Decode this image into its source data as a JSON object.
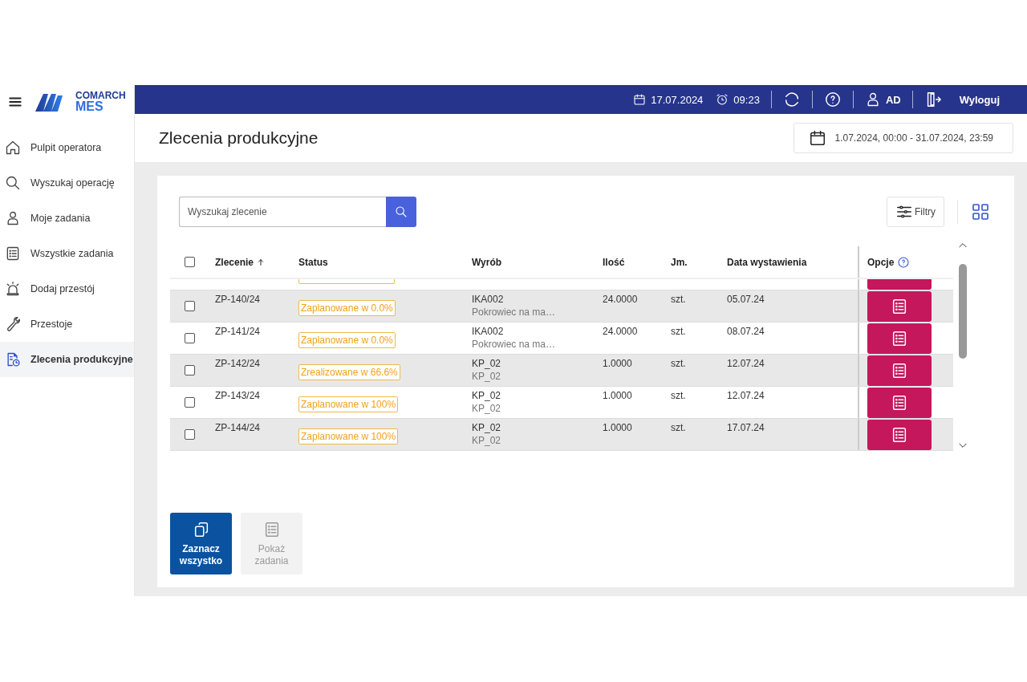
{
  "brand": {
    "company": "COMARCH",
    "product": "MES"
  },
  "sidebar": {
    "items": [
      {
        "label": "Pulpit operatora",
        "kind": "home",
        "selected": false
      },
      {
        "label": "Wyszukaj operację",
        "kind": "search",
        "selected": false
      },
      {
        "label": "Moje zadania",
        "kind": "user",
        "selected": false
      },
      {
        "label": "Wszystkie zadania",
        "kind": "list",
        "selected": false
      },
      {
        "label": "Dodaj przestój",
        "kind": "alarm",
        "selected": false
      },
      {
        "label": "Przestoje",
        "kind": "wrench",
        "selected": false
      },
      {
        "label": "Zlecenia produkcyjne",
        "kind": "orders",
        "selected": true
      }
    ]
  },
  "top_bar": {
    "date": "17.07.2024",
    "time": "09:23",
    "user": "AD",
    "logout": "Wyloguj"
  },
  "page": {
    "title": "Zlecenia produkcyjne",
    "date_range": "1.07.2024, 00:00 - 31.07.2024, 23:59"
  },
  "search": {
    "placeholder": "Wyszukaj zlecenie"
  },
  "filters_button": "Filtry",
  "table": {
    "columns": [
      "Zlecenie",
      "Status",
      "Wyrób",
      "Ilość",
      "Jm.",
      "Data wystawienia",
      "Opcje"
    ],
    "select_all_checked": false,
    "rows": [
      {
        "order": "ZP-140/24",
        "status": "Zaplanowane w 0.0%",
        "product_code": "IKA002",
        "product_name": "Pokrowiec na ma…",
        "quantity": "24.0000",
        "unit": "szt.",
        "date": "05.07.24",
        "checked": false
      },
      {
        "order": "ZP-141/24",
        "status": "Zaplanowane w 0.0%",
        "product_code": "IKA002",
        "product_name": "Pokrowiec na ma…",
        "quantity": "24.0000",
        "unit": "szt.",
        "date": "08.07.24",
        "checked": false
      },
      {
        "order": "ZP-142/24",
        "status": "Zrealizowane w 66.6%",
        "product_code": "KP_02",
        "product_name": "KP_02",
        "quantity": "1.0000",
        "unit": "szt.",
        "date": "12.07.24",
        "checked": false
      },
      {
        "order": "ZP-143/24",
        "status": "Zaplanowane w 100%",
        "product_code": "KP_02",
        "product_name": "KP_02",
        "quantity": "1.0000",
        "unit": "szt.",
        "date": "12.07.24",
        "checked": false
      },
      {
        "order": "ZP-144/24",
        "status": "Zaplanowane w 100%",
        "product_code": "KP_02",
        "product_name": "KP_02",
        "quantity": "1.0000",
        "unit": "szt.",
        "date": "17.07.24",
        "checked": false
      }
    ]
  },
  "actions": [
    {
      "label": "Zaznacz wszystko",
      "kind": "copy",
      "disabled": false
    },
    {
      "label": "Pokaż zadania",
      "kind": "list",
      "disabled": true
    }
  ]
}
